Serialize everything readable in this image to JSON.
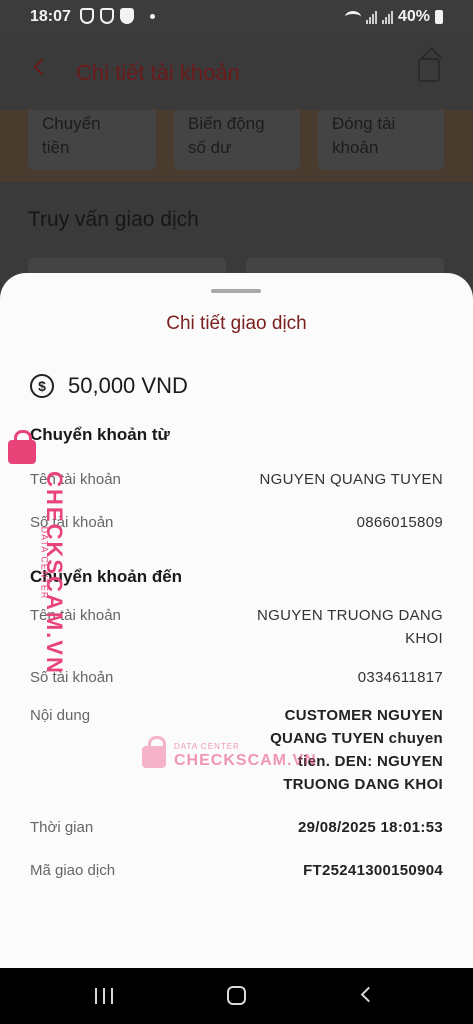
{
  "status_bar": {
    "time": "18:07",
    "battery": "40%"
  },
  "header": {
    "title": "Chi tiết tài khoản"
  },
  "quick_actions": [
    {
      "line1": "Chuyển",
      "line2": "tiền"
    },
    {
      "line1": "Biến động",
      "line2": "số dư"
    },
    {
      "line1": "Đóng tài",
      "line2": "khoản"
    }
  ],
  "background_section_title": "Truy vấn giao dịch",
  "sheet": {
    "title": "Chi tiết giao dịch",
    "amount": "50,000 VND",
    "from_section": "Chuyển khoản từ",
    "from_name_label": "Tên tài khoản",
    "from_name": "NGUYEN QUANG TUYEN",
    "from_account_label": "Số tài khoản",
    "from_account": "0866015809",
    "to_section": "Chuyển khoản đến",
    "to_name_label": "Tên tài khoản",
    "to_name_line1": "NGUYEN TRUONG DANG",
    "to_name_line2": "KHOI",
    "to_account_label": "Số tài khoản",
    "to_account": "0334611817",
    "content_label": "Nội dung",
    "content_line1": "CUSTOMER NGUYEN",
    "content_line2": "QUANG TUYEN chuyen",
    "content_line3": "tien. DEN: NGUYEN",
    "content_line4": "TRUONG DANG KHOI",
    "time_label": "Thời gian",
    "time_value": "29/08/2025 18:01:53",
    "txid_label": "Mã giao dịch",
    "txid_value": "FT25241300150904"
  },
  "watermark": {
    "brand": "CHECKSCAM.VN",
    "sub": "DATA CENTER"
  }
}
